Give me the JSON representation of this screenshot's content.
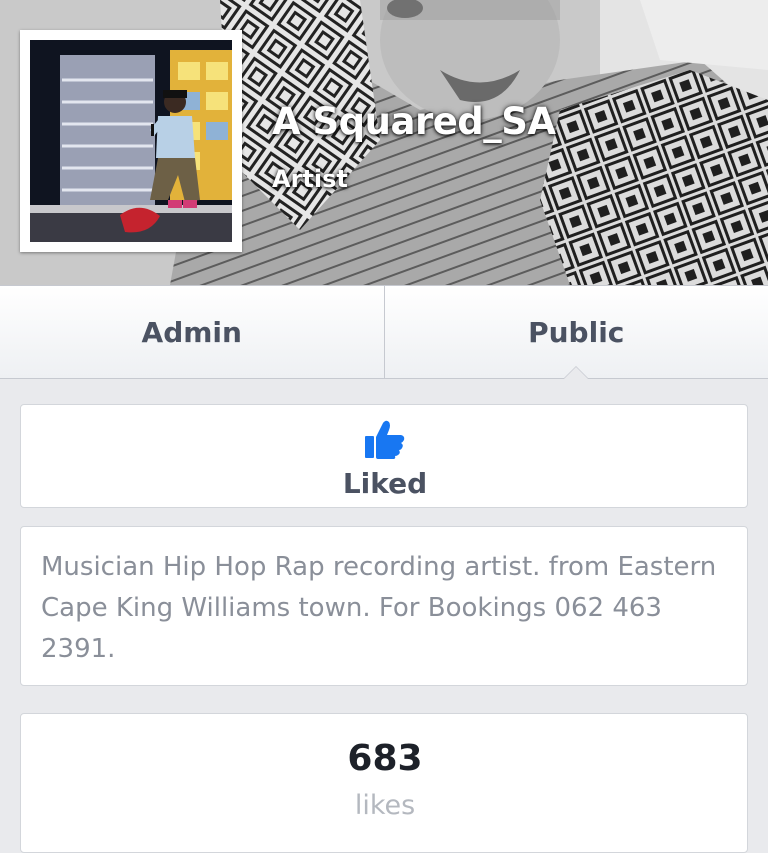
{
  "header": {
    "page_name": "A Squared_SA",
    "category": "Artist"
  },
  "tabs": [
    {
      "label": "Admin",
      "active": false
    },
    {
      "label": "Public",
      "active": true
    }
  ],
  "like_button": {
    "label": "Liked",
    "icon": "thumbs-up-icon",
    "icon_color": "#1877f2"
  },
  "about": {
    "text": "Musician Hip Hop Rap recording artist. from Eastern Cape King Williams town.  For Bookings 062 463 2391."
  },
  "stats": {
    "likes_count": "683",
    "likes_label": "likes"
  }
}
